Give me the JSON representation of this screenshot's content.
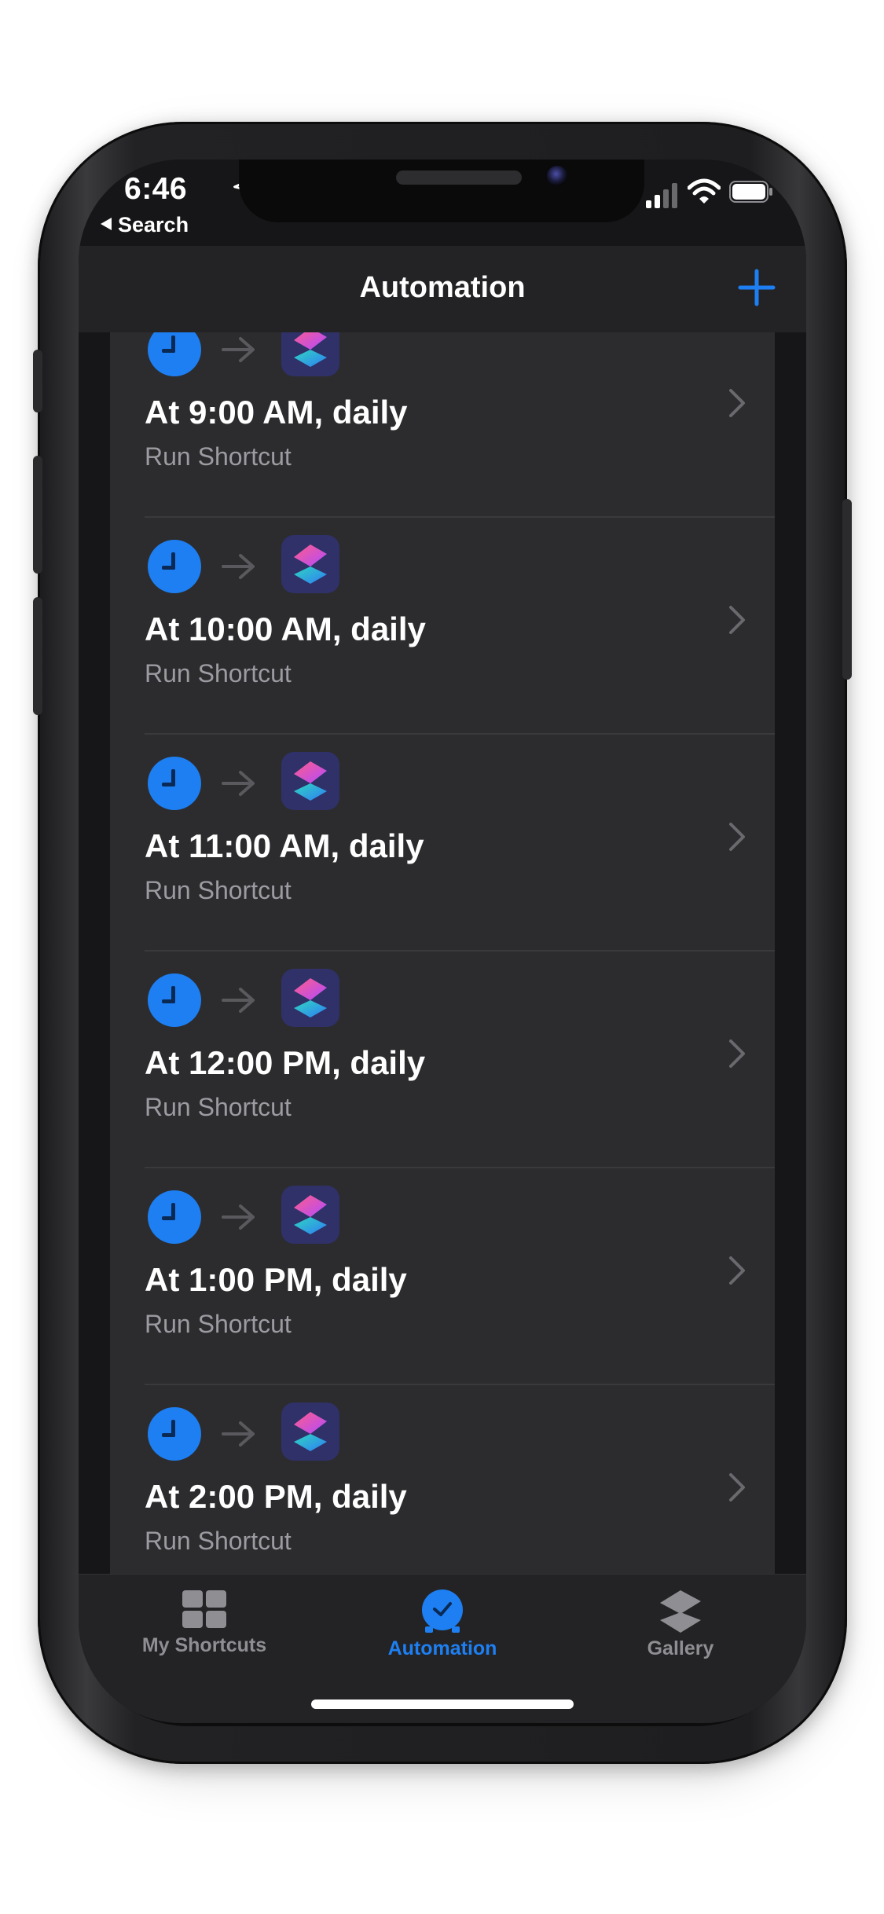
{
  "status": {
    "time": "6:46",
    "back_label": "Search"
  },
  "nav": {
    "title": "Automation",
    "add_icon": "plus-icon"
  },
  "automations": [
    {
      "title": "At 9:00 AM, daily",
      "subtitle": "Run Shortcut"
    },
    {
      "title": "At 10:00 AM, daily",
      "subtitle": "Run Shortcut"
    },
    {
      "title": "At 11:00 AM, daily",
      "subtitle": "Run Shortcut"
    },
    {
      "title": "At 12:00 PM, daily",
      "subtitle": "Run Shortcut"
    },
    {
      "title": "At 1:00 PM, daily",
      "subtitle": "Run Shortcut"
    },
    {
      "title": "At 2:00 PM, daily",
      "subtitle": "Run Shortcut"
    }
  ],
  "tabs": [
    {
      "label": "My Shortcuts",
      "icon": "grid-icon",
      "active": false
    },
    {
      "label": "Automation",
      "icon": "automation-clock-icon",
      "active": true
    },
    {
      "label": "Gallery",
      "icon": "layers-icon",
      "active": false
    }
  ],
  "colors": {
    "accent": "#1d7ff2",
    "background": "#161618",
    "card": "#2c2c2e",
    "secondary_text": "#9b9ba1"
  }
}
